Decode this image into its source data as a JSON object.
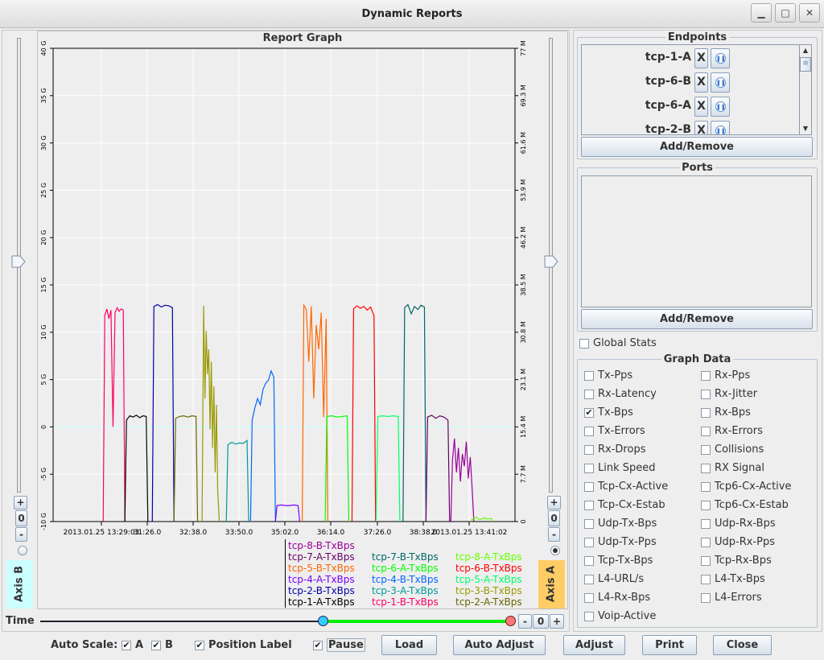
{
  "window": {
    "title": "Dynamic Reports",
    "controls": [
      "minimize-icon",
      "maximize-icon",
      "close-icon"
    ]
  },
  "graph": {
    "title": "Report Graph",
    "axis_b_label": "Axis B",
    "axis_a_label": "Axis A",
    "zero_label": "0",
    "plus_label": "+",
    "minus_label": "-",
    "time_label": "Time",
    "axis_a_radio_selected": true,
    "axis_b_radio_selected": false,
    "time_slider_start_fraction": 0.0,
    "time_slider_range": [
      0.6,
      1.0
    ]
  },
  "chart_data": {
    "type": "line",
    "title": "Report Graph",
    "xlim": [
      "13:28:58",
      "13:41:02"
    ],
    "x_tick_labels": [
      "2013.01.25 13:29:03",
      "31:26.0",
      "32:38.0",
      "33:50.0",
      "35:02.0",
      "36:14.0",
      "37:26.0",
      "38:38.0",
      "2013.01.25 13:41:02"
    ],
    "y_left": {
      "ylim": [
        -10,
        40
      ],
      "ticks": [
        "-10 G",
        "-5 G",
        "0",
        "5 G",
        "10 G",
        "15 G",
        "20 G",
        "25 G",
        "30 G",
        "35 G",
        "40 G"
      ]
    },
    "y_right": {
      "ylim": [
        0,
        77
      ],
      "unit": "M",
      "ticks": [
        "0",
        "7.7 M",
        "15.4 M",
        "23.1 M",
        "30.8 M",
        "38.5 M",
        "46.2 M",
        "53.9 M",
        "61.6 M",
        "69.3 M",
        "77 M"
      ]
    },
    "grid": true,
    "legend_position": "bottom",
    "series": [
      {
        "name": "tcp-1-B-TxBps",
        "color": "#ff0066",
        "start": "13:30:19",
        "end": "13:30:48",
        "values": [
          33.5,
          34.6,
          33.0,
          34.4,
          15.4,
          34.0,
          34.8,
          34.2,
          34.6,
          34.4
        ]
      },
      {
        "name": "tcp-1-A-TxBps",
        "color": "#000000",
        "start": "13:30:53",
        "end": "13:31:24",
        "values": [
          16.5,
          17.2,
          17.0,
          17.3,
          16.9,
          17.2,
          17.1
        ]
      },
      {
        "name": "tcp-2-B-TxBps",
        "color": "#0000aa",
        "start": "13:31:36",
        "end": "13:32:05",
        "values": [
          35.0,
          35.3,
          34.9,
          35.2,
          35.1,
          34.8
        ]
      },
      {
        "name": "tcp-2-A-TxBps",
        "color": "#666600",
        "start": "13:32:10",
        "end": "13:32:42",
        "values": [
          16.8,
          17.1,
          17.2,
          17.0,
          17.2,
          17.1
        ]
      },
      {
        "name": "tcp-3-B-TxBps",
        "color": "#999900",
        "start": "13:32:54",
        "end": "13:33:16",
        "values": [
          35.1,
          20.0,
          31.0,
          24.0,
          28.0,
          15.0,
          26.0,
          12.0,
          22.0,
          8.0,
          19.0,
          5.0
        ]
      },
      {
        "name": "tcp-3-A-TxBps",
        "color": "#009999",
        "start": "13:33:32",
        "end": "13:34:02",
        "values": [
          12.5,
          12.9,
          12.6,
          12.8,
          12.7,
          13.2
        ]
      },
      {
        "name": "tcp-4-B-TxBps",
        "color": "#0066ff",
        "start": "13:34:10",
        "end": "13:34:44",
        "values": [
          16.5,
          18.5,
          20.0,
          19.0,
          21.5,
          22.5,
          23.0,
          24.5,
          23.5
        ]
      },
      {
        "name": "tcp-4-A-TxBps",
        "color": "#7700ff",
        "start": "13:34:49",
        "end": "13:35:22",
        "values": [
          2.6,
          2.7,
          2.6,
          2.6,
          2.7,
          2.6
        ]
      },
      {
        "name": "tcp-5-B-TxBps",
        "color": "#ff6600",
        "start": "13:35:31",
        "end": "13:36:06",
        "values": [
          35.2,
          34.5,
          26.0,
          35.0,
          20.0,
          32.0,
          28.0,
          34.0,
          17.0,
          33.0
        ]
      },
      {
        "name": "tcp-6-A-TxBps",
        "color": "#00ff00",
        "start": "13:36:07",
        "end": "13:36:39",
        "values": [
          17.1,
          17.2,
          17.0,
          17.1,
          17.2
        ]
      },
      {
        "name": "tcp-6-B-TxBps",
        "color": "#ff0000",
        "start": "13:36:49",
        "end": "13:37:21",
        "values": [
          34.6,
          35.1,
          34.7,
          35.0,
          34.4,
          34.9,
          33.5
        ]
      },
      {
        "name": "tcp-5-A-TxBps",
        "color": "#00ff66",
        "start": "13:37:27",
        "end": "13:37:59",
        "values": [
          17.1,
          17.2,
          17.1,
          17.2,
          17.1
        ]
      },
      {
        "name": "tcp-7-B-TxBps",
        "color": "#006666",
        "start": "13:38:09",
        "end": "13:38:40",
        "values": [
          34.8,
          35.3,
          33.8,
          35.0,
          34.5,
          35.2,
          34.9
        ]
      },
      {
        "name": "tcp-7-A-TxBps",
        "color": "#660066",
        "start": "13:38:45",
        "end": "13:39:17",
        "values": [
          17.0,
          17.3,
          16.8,
          17.2,
          17.0,
          16.5
        ]
      },
      {
        "name": "tcp-8-B-TxBps",
        "color": "#990099",
        "start": "13:39:24",
        "end": "13:39:55",
        "values": [
          10.0,
          13.5,
          8.0,
          12.0,
          6.5,
          11.0,
          9.0,
          13.0,
          7.0,
          10.5,
          5.0
        ]
      },
      {
        "name": "tcp-8-A-TxBps",
        "color": "#66ff00",
        "start": "13:39:55",
        "end": "13:40:25",
        "values": [
          0.4,
          0.7,
          0.3,
          0.6,
          0.4,
          0.5
        ]
      }
    ]
  },
  "legend": {
    "columns": [
      [
        "tcp-8-B-TxBps",
        "tcp-7-A-TxBps",
        "tcp-5-B-TxBps",
        "tcp-4-A-TxBps",
        "tcp-2-B-TxBps",
        "tcp-1-A-TxBps"
      ],
      [
        "",
        "tcp-7-B-TxBps",
        "tcp-6-A-TxBps",
        "tcp-4-B-TxBps",
        "tcp-3-A-TxBps",
        "tcp-1-B-TxBps"
      ],
      [
        "",
        "tcp-8-A-TxBps",
        "tcp-6-B-TxBps",
        "tcp-5-A-TxBps",
        "tcp-3-B-TxBps",
        "tcp-2-A-TxBps"
      ]
    ]
  },
  "endpoints": {
    "title": "Endpoints",
    "items": [
      "tcp-1-A",
      "tcp-6-B",
      "tcp-6-A",
      "tcp-2-B"
    ],
    "remove_label": "X",
    "add_remove_label": "Add/Remove"
  },
  "ports": {
    "title": "Ports",
    "add_remove_label": "Add/Remove"
  },
  "global_stats": {
    "label": "Global Stats",
    "checked": false
  },
  "graph_data": {
    "title": "Graph Data",
    "items": [
      {
        "label": "Tx-Pps",
        "checked": false
      },
      {
        "label": "Rx-Pps",
        "checked": false
      },
      {
        "label": "Rx-Latency",
        "checked": false
      },
      {
        "label": "Rx-Jitter",
        "checked": false
      },
      {
        "label": "Tx-Bps",
        "checked": true
      },
      {
        "label": "Rx-Bps",
        "checked": false
      },
      {
        "label": "Tx-Errors",
        "checked": false
      },
      {
        "label": "Rx-Errors",
        "checked": false
      },
      {
        "label": "Rx-Drops",
        "checked": false
      },
      {
        "label": "Collisions",
        "checked": false
      },
      {
        "label": "Link Speed",
        "checked": false
      },
      {
        "label": "RX Signal",
        "checked": false
      },
      {
        "label": "Tcp-Cx-Active",
        "checked": false
      },
      {
        "label": "Tcp6-Cx-Active",
        "checked": false
      },
      {
        "label": "Tcp-Cx-Estab",
        "checked": false
      },
      {
        "label": "Tcp6-Cx-Estab",
        "checked": false
      },
      {
        "label": "Udp-Tx-Bps",
        "checked": false
      },
      {
        "label": "Udp-Rx-Bps",
        "checked": false
      },
      {
        "label": "Udp-Tx-Pps",
        "checked": false
      },
      {
        "label": "Udp-Rx-Pps",
        "checked": false
      },
      {
        "label": "Tcp-Tx-Bps",
        "checked": false
      },
      {
        "label": "Tcp-Rx-Bps",
        "checked": false
      },
      {
        "label": "L4-URL/s",
        "checked": false
      },
      {
        "label": "L4-Tx-Bps",
        "checked": false
      },
      {
        "label": "L4-Rx-Bps",
        "checked": false
      },
      {
        "label": "L4-Errors",
        "checked": false
      },
      {
        "label": "Voip-Active",
        "checked": false
      }
    ]
  },
  "bottom": {
    "auto_scale_label": "Auto Scale:",
    "a_label": "A",
    "a_checked": true,
    "b_label": "B",
    "b_checked": true,
    "position_label": "Position Label",
    "position_checked": true,
    "pause_label": "Pause",
    "pause_checked": true,
    "buttons": [
      "Load",
      "Auto Adjust",
      "Adjust",
      "Print",
      "Close"
    ]
  }
}
